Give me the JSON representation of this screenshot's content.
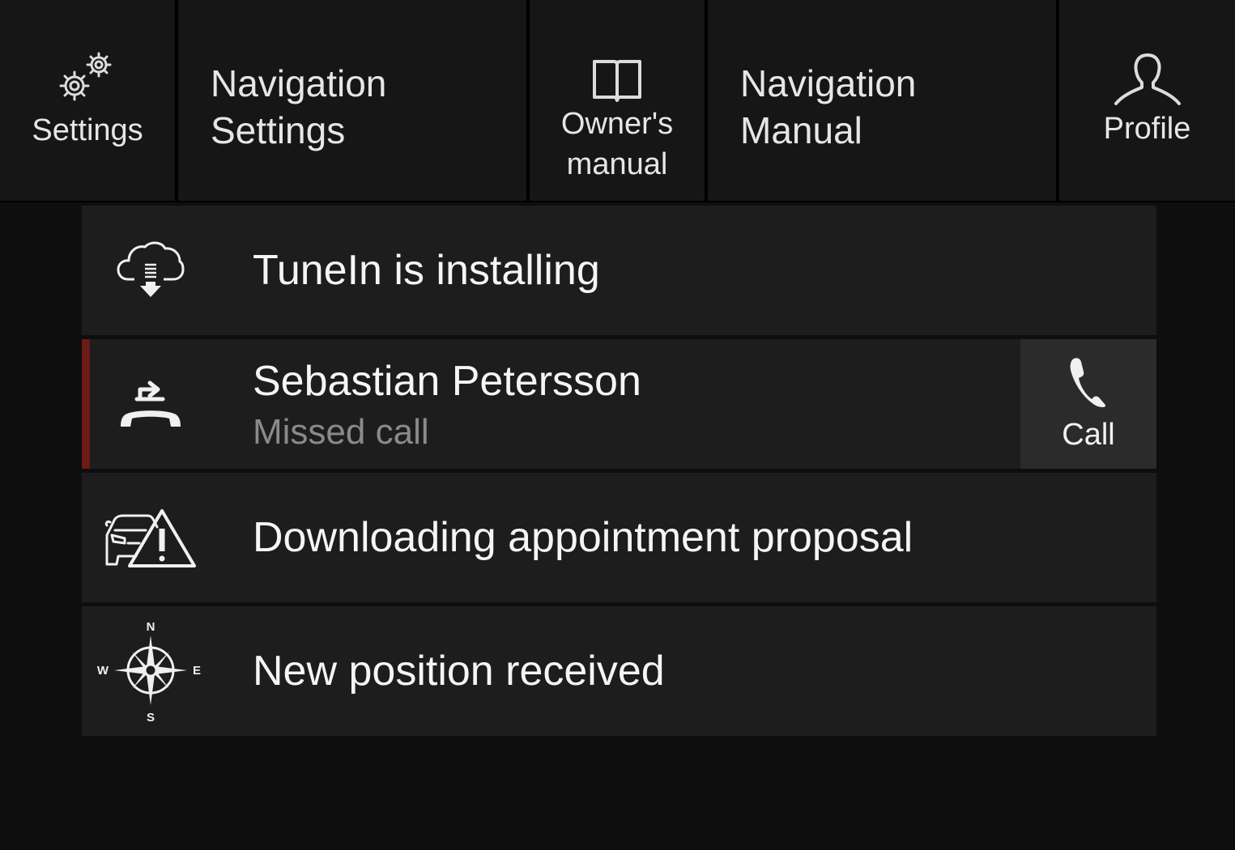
{
  "topbar": {
    "settings": {
      "label": "Settings",
      "icon": "gears-icon"
    },
    "nav_settings": {
      "line1": "Navigation",
      "line2": "Settings"
    },
    "owners_manual": {
      "line1": "Owner's",
      "line2": "manual",
      "icon": "book-icon"
    },
    "nav_manual": {
      "line1": "Navigation",
      "line2": "Manual"
    },
    "profile": {
      "label": "Profile",
      "icon": "person-icon"
    }
  },
  "notifications": [
    {
      "icon": "cloud-download-icon",
      "title": "TuneIn is installing"
    },
    {
      "icon": "missed-call-icon",
      "title": "Sebastian Petersson",
      "subtitle": "Missed call",
      "action_label": "Call",
      "action_icon": "phone-icon",
      "accent": "#6b1a17"
    },
    {
      "icon": "car-warning-icon",
      "title": "Downloading appointment proposal"
    },
    {
      "icon": "compass-icon",
      "title": "New position received",
      "compass": {
        "n": "N",
        "e": "E",
        "s": "S",
        "w": "W"
      }
    }
  ],
  "colors": {
    "background": "#0e0e0e",
    "tile": "#161616",
    "card": "#1d1d1d",
    "call_button": "#2b2b2b",
    "missed_accent": "#6b1a17",
    "subtitle": "#8a8a8a"
  }
}
